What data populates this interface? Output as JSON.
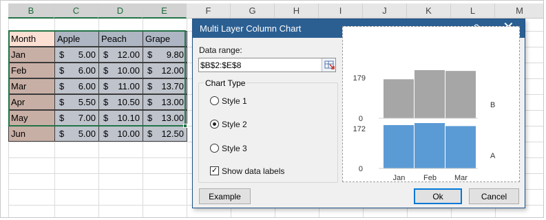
{
  "columns": [
    "B",
    "C",
    "D",
    "E",
    "F",
    "G",
    "H",
    "I",
    "J",
    "K",
    "L",
    "M"
  ],
  "table": {
    "headers": [
      "Month",
      "Apple",
      "Peach",
      "Grape"
    ],
    "rows": [
      {
        "month": "Jan",
        "apple": "5.00",
        "peach": "12.00",
        "grape": "9.80"
      },
      {
        "month": "Feb",
        "apple": "6.00",
        "peach": "10.00",
        "grape": "12.00"
      },
      {
        "month": "Mar",
        "apple": "6.00",
        "peach": "11.00",
        "grape": "13.70"
      },
      {
        "month": "Apr",
        "apple": "5.50",
        "peach": "10.50",
        "grape": "13.00"
      },
      {
        "month": "May",
        "apple": "7.00",
        "peach": "10.10",
        "grape": "13.00"
      },
      {
        "month": "Jun",
        "apple": "5.00",
        "peach": "10.00",
        "grape": "12.50"
      }
    ],
    "currency": "$"
  },
  "colors": {
    "header_month": "#fbdfd2",
    "header_fruit": "#aeb6c3",
    "month_col": "#c8afa5",
    "data_cells": "#bfc3cc",
    "excel_green": "#217346",
    "dialog_title": "#2b5f92",
    "layer_top": "#a6a6a6",
    "layer_bottom": "#5b9bd5"
  },
  "dialog": {
    "title": "Multi Layer Column Chart",
    "help": "?",
    "close": "✕",
    "data_range_label": "Data range:",
    "data_range_value": "$B$2:$E$8",
    "chart_type_label": "Chart Type",
    "styles": [
      {
        "label": "Style 1",
        "selected": false
      },
      {
        "label": "Style 2",
        "selected": true
      },
      {
        "label": "Style 3",
        "selected": false
      }
    ],
    "show_labels_label": "Show data labels",
    "show_labels_checked": true,
    "example_btn": "Example",
    "ok_btn": "Ok",
    "cancel_btn": "Cancel"
  },
  "chart_data": {
    "type": "bar",
    "categories": [
      "Jan",
      "Feb",
      "Mar"
    ],
    "series": [
      {
        "name": "A",
        "values": [
          172,
          180,
          168
        ],
        "max_label": "172",
        "min_label": "0"
      },
      {
        "name": "B",
        "values": [
          145,
          179,
          176
        ],
        "max_label": "179",
        "min_label": "0"
      }
    ],
    "title": "",
    "xlabel": "",
    "ylabel": ""
  }
}
